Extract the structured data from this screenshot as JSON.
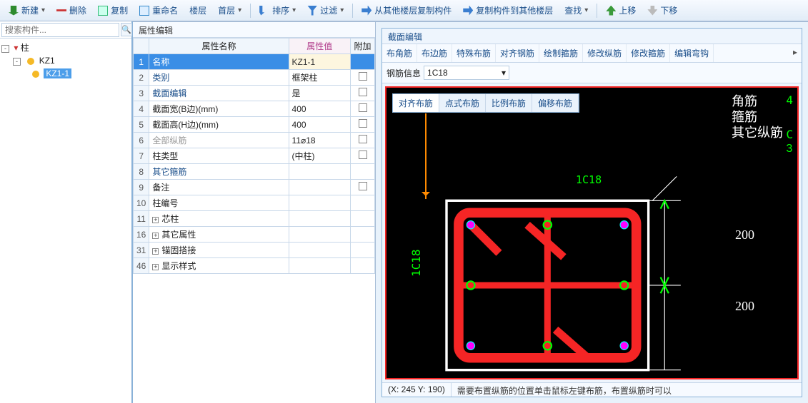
{
  "toolbar": {
    "new": "新建",
    "del": "删除",
    "copy": "复制",
    "rename": "重命名",
    "floor": "楼层",
    "floor_val": "首层",
    "sort": "排序",
    "filter": "过滤",
    "import": "从其他楼层复制构件",
    "export": "复制构件到其他楼层",
    "find": "查找",
    "up": "上移",
    "down": "下移"
  },
  "search_placeholder": "搜索构件...",
  "tree": {
    "root": "柱",
    "child": "KZ1",
    "leaf": "KZ1-1"
  },
  "prop_panel": {
    "title": "属性编辑"
  },
  "prop_headers": {
    "name": "属性名称",
    "value": "属性值",
    "extra": "附加"
  },
  "props": [
    {
      "n": "1",
      "name": "名称",
      "value": "KZ1-1",
      "sel": true
    },
    {
      "n": "2",
      "name": "类别",
      "value": "框架柱",
      "blue": true,
      "chk": true
    },
    {
      "n": "3",
      "name": "截面编辑",
      "value": "是",
      "blue": true,
      "chk": true
    },
    {
      "n": "4",
      "name": "截面宽(B边)(mm)",
      "value": "400",
      "chk": true
    },
    {
      "n": "5",
      "name": "截面高(H边)(mm)",
      "value": "400",
      "chk": true
    },
    {
      "n": "6",
      "name": "全部纵筋",
      "value": "11⌀18",
      "gray": true,
      "chk": true
    },
    {
      "n": "7",
      "name": "柱类型",
      "value": "(中柱)",
      "chk": true
    },
    {
      "n": "8",
      "name": "其它箍筋",
      "value": "",
      "blue": true
    },
    {
      "n": "9",
      "name": "备注",
      "value": "",
      "chk": true
    },
    {
      "n": "10",
      "name": "柱编号",
      "value": ""
    },
    {
      "n": "11",
      "name": "芯柱",
      "value": "",
      "exp": true
    },
    {
      "n": "16",
      "name": "其它属性",
      "value": "",
      "exp": true
    },
    {
      "n": "31",
      "name": "锚固搭接",
      "value": "",
      "exp": true
    },
    {
      "n": "46",
      "name": "显示样式",
      "value": "",
      "exp": true
    }
  ],
  "cs": {
    "title": "截面编辑",
    "tabs": [
      "布角筋",
      "布边筋",
      "特殊布筋",
      "对齐钢筋",
      "绘制箍筋",
      "修改纵筋",
      "修改箍筋",
      "编辑弯钩"
    ],
    "info_label": "钢筋信息",
    "info_value": "1C18",
    "subtabs": [
      "对齐布筋",
      "点式布筋",
      "比例布筋",
      "偏移布筋"
    ],
    "labels": [
      "角筋",
      "箍筋",
      "其它纵筋"
    ],
    "dim_top": "1C18",
    "dim_left": "1C18",
    "dim200a": "200",
    "dim200b": "200",
    "num_r1": "4",
    "num_r2": "C",
    "num_r3": "3",
    "status_xy": "(X: 245 Y: 190)",
    "status_hint": "需要布置纵筋的位置单击鼠标左键布筋，布置纵筋时可以"
  }
}
